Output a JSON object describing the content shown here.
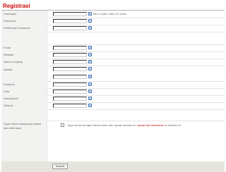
{
  "page": {
    "title": "Registrasi"
  },
  "form": {
    "username": {
      "label": "Username",
      "value": "",
      "hint": "Min 6 chars. Max 32 chars"
    },
    "password": {
      "label": "Password",
      "value": ""
    },
    "confirm_password": {
      "label": "Konfirmasi Password",
      "value": ""
    },
    "email": {
      "label": "Email",
      "value": ""
    },
    "website": {
      "label": "Website",
      "value": ""
    },
    "nama_lengkap": {
      "label": "Nama Lengkap",
      "value": ""
    },
    "alamat": {
      "label": "Alamat",
      "value": ""
    },
    "alamat_2": {
      "value": ""
    },
    "kodepos": {
      "label": "Kodepos",
      "value": ""
    },
    "kota": {
      "label": "Kota",
      "value": ""
    },
    "handphone": {
      "label": "Handphone",
      "value": ""
    },
    "telepon": {
      "label": "Telepon",
      "value": ""
    }
  },
  "agreement": {
    "label": "Saya harus menyetujui syarat dan ketentuan",
    "text_before": "Saya setuju dengan aturan main dan syarat website ini, ",
    "link_text": "syarat dan ketentuan",
    "text_after": " di website ini",
    "checked": false
  },
  "submit": {
    "label": "Submit"
  },
  "colors": {
    "title": "#cc0000",
    "label_bg": "#f2f2f0",
    "footer_bg": "#e5e5dd",
    "help_icon": "#3a6fb0"
  },
  "icons": {
    "help": "help-icon"
  }
}
